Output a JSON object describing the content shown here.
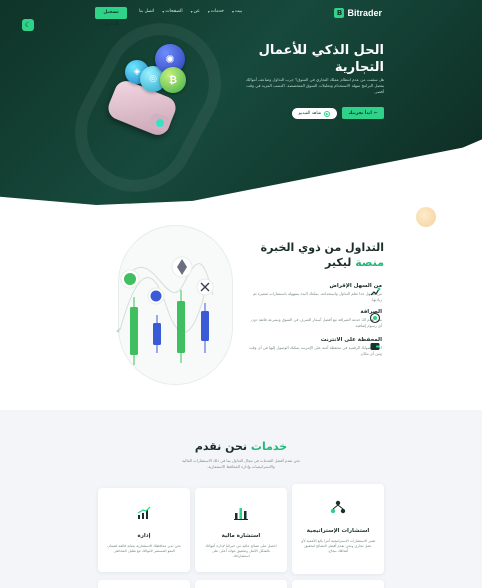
{
  "header": {
    "brand": "Bitrader",
    "nav": [
      {
        "label": "بيت",
        "dropdown": true
      },
      {
        "label": "خدمات",
        "dropdown": true
      },
      {
        "label": "عن",
        "dropdown": true
      },
      {
        "label": "الصفحات",
        "dropdown": true
      },
      {
        "label": "اتصل بنا",
        "dropdown": false
      }
    ],
    "cta": "تسجيل الدخول"
  },
  "hero": {
    "title": "الحل الذكي للأعمال التجارية",
    "description": "هل سئمت من عدم انتظام عملك التجاري في السوق؟ جرب التداول وضاعف أموالك بفضل البرامج سهلة الاستخدام وتحليلات السوق المتخصصة. اكتسب المزيد في وقت أقصر.",
    "primary_button": "ابدأ تجربتك",
    "video_button": "شاهد الفيديو"
  },
  "section_experience": {
    "title_line1": "التداول من ذوي الخبرة",
    "title_accent": "منصة",
    "title_rest": "ليكير",
    "features": [
      {
        "title": "من السهل الإقراض",
        "desc": "من السهل جدا تعلم التداول واستخدامه. يمكنك البدء بسهولة باستثمارات صغيرة ثم زيادتها."
      },
      {
        "title": "الصرافة",
        "desc": "نحن نقدم لك خدمة الصرافة مع أفضل أسعار الصرف في السوق وبسرعة فائقة دون أي رسوم إضافية."
      },
      {
        "title": "المحفظة على الانترنت",
        "desc": "احفظ أصولك الرقمية في محفظة آمنة على الإنترنت يمكنك الوصول إليها في أي وقت ومن أي مكان."
      }
    ]
  },
  "section_services": {
    "title_accent": "خدمات",
    "title_rest": "نحن نقدم",
    "description": "نحن نقدم أفضل الخدمات في مجال التداول بما في ذلك الاستشارات المالية والاستراتيجيات وإدارة المحافظ الاستثمارية.",
    "cards": [
      {
        "title": "استشارات الإستراتيجية",
        "desc": "تعتبر الاستشارات الاستراتيجية أمرا بالغ الأهمية لأي عمل تجاري ونحن نقدم أفضل النصائح لتحقيق أهدافك بنجاح.",
        "icon": "strategy-network-icon"
      },
      {
        "title": "استشارة مالية",
        "desc": "احصل على نصائح مالية من خبرائنا لإدارة أموالك بالشكل الأمثل وتحقيق عوائد أعلى على استثماراتك.",
        "icon": "bar-chart-icon"
      },
      {
        "title": "إدارة",
        "desc": "نحن ندير محافظك الاستثمارية بعناية فائقة لضمان النمو المستمر لأموالك مع تقليل المخاطر.",
        "icon": "growth-chart-icon"
      }
    ]
  },
  "colors": {
    "accent": "#2ed389",
    "dark_green": "#0f3328",
    "accent_text": "#22b979"
  }
}
